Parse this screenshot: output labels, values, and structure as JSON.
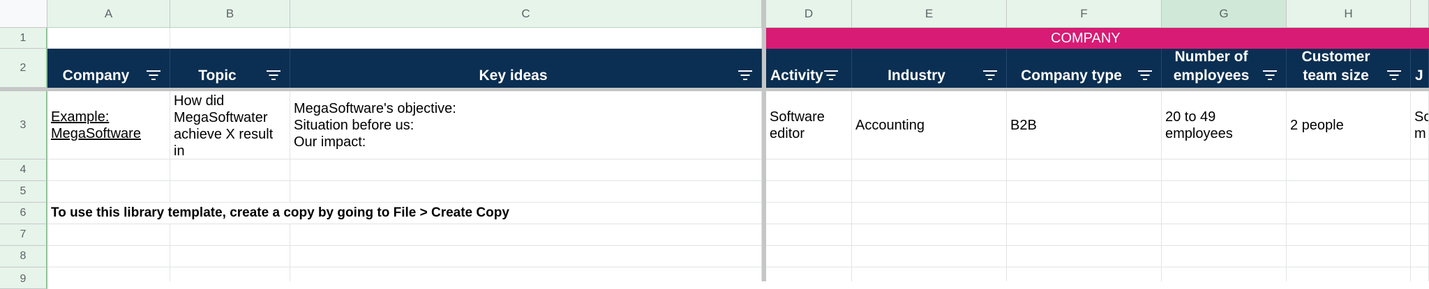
{
  "columns": [
    "A",
    "B",
    "C",
    "D",
    "E",
    "F",
    "G",
    "H"
  ],
  "rows": [
    "1",
    "2",
    "3",
    "4",
    "5",
    "6",
    "7",
    "8",
    "9"
  ],
  "group_header": {
    "label": "COMPANY",
    "color": "#d81b75"
  },
  "headers": {
    "company": "Company",
    "topic": "Topic",
    "key_ideas": "Key ideas",
    "activity": "Activity",
    "industry": "Industry",
    "company_type": "Company type",
    "employees": "Number of\nemployees",
    "team_size": "Customer\nteam size",
    "next_partial": "J"
  },
  "row3": {
    "company": "Example:\nMegaSoftware",
    "topic": "How did\nMegaSoftwater\nachieve X result in\nless than Y days?",
    "key_ideas": "MegaSoftware's objective:\nSituation before us:\nOur impact:",
    "activity": "Software\neditor",
    "industry": "Accounting",
    "company_type": "B2B",
    "employees": "20 to 49\nemployees",
    "team_size": "2 people",
    "next_partial": "So\nm"
  },
  "row6": {
    "note": "To use this library template, create a copy by going to File > Create Copy"
  },
  "colors": {
    "header_bg": "#0b2f52",
    "accent": "#d81b75"
  }
}
